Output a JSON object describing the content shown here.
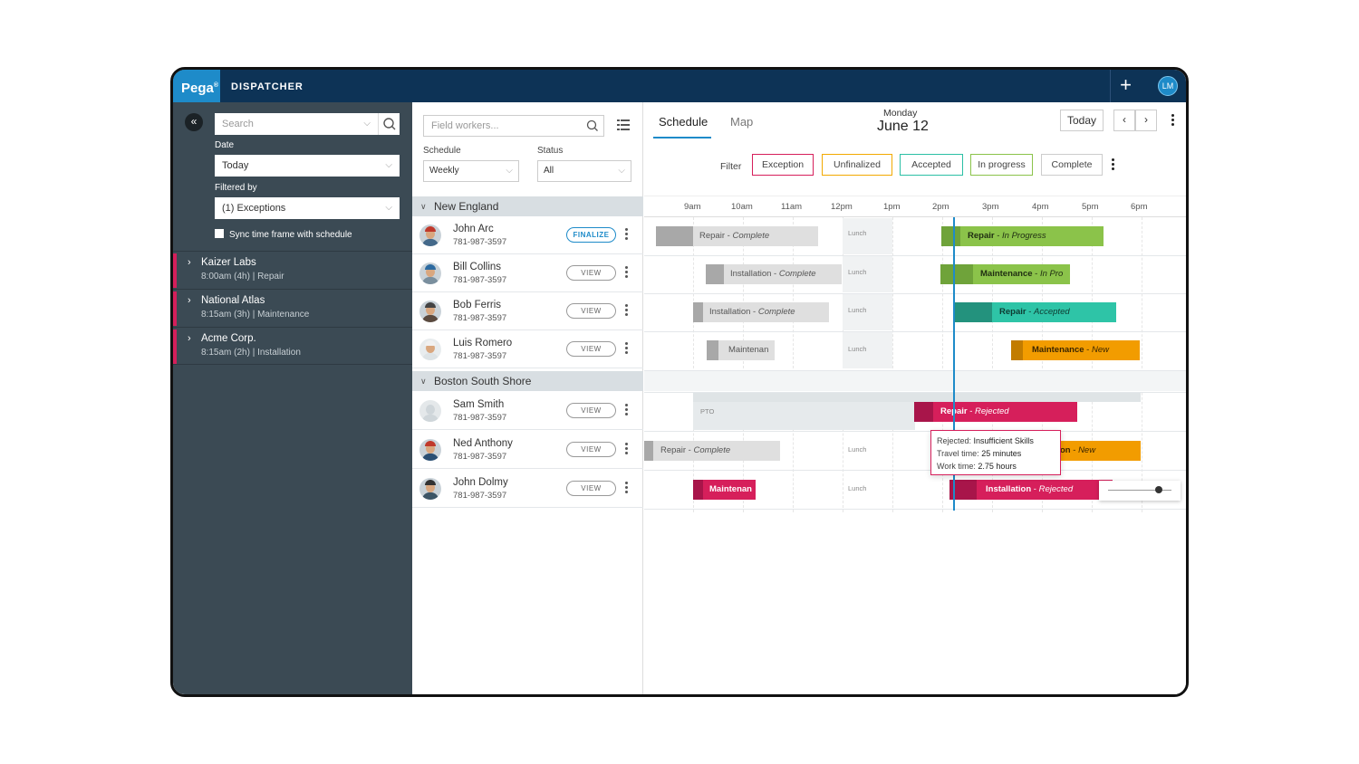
{
  "app": {
    "logo": "Pega",
    "logo_mark": "®",
    "title": "DISPATCHER",
    "user_initials": "LM"
  },
  "left_panel": {
    "search_placeholder": "Search",
    "date_label": "Date",
    "date_value": "Today",
    "filtered_label": "Filtered by",
    "filtered_value": "(1) Exceptions",
    "sync_label": "Sync time frame with schedule",
    "jobs": [
      {
        "title": "Kaizer Labs",
        "sub": "8:00am (4h) | Repair"
      },
      {
        "title": "National Atlas",
        "sub": "8:15am (3h) | Maintenance"
      },
      {
        "title": "Acme Corp.",
        "sub": "8:15am (2h) | Installation"
      }
    ]
  },
  "middle_panel": {
    "search_placeholder": "Field workers...",
    "schedule_label": "Schedule",
    "schedule_value": "Weekly",
    "status_label": "Status",
    "status_value": "All",
    "groups": [
      {
        "name": "New England",
        "workers": [
          {
            "name": "John Arc",
            "phone": "781-987-3597",
            "action": "FINALIZE"
          },
          {
            "name": "Bill Collins",
            "phone": "781-987-3597",
            "action": "VIEW"
          },
          {
            "name": "Bob Ferris",
            "phone": "781-987-3597",
            "action": "VIEW"
          },
          {
            "name": "Luis Romero",
            "phone": "781-987-3597",
            "action": "VIEW"
          }
        ]
      },
      {
        "name": "Boston South Shore",
        "workers": [
          {
            "name": "Sam Smith",
            "phone": "781-987-3597",
            "action": "VIEW"
          },
          {
            "name": "Ned Anthony",
            "phone": "781-987-3597",
            "action": "VIEW"
          },
          {
            "name": "John Dolmy",
            "phone": "781-987-3597",
            "action": "VIEW"
          }
        ]
      }
    ]
  },
  "schedule": {
    "tab_schedule": "Schedule",
    "tab_map": "Map",
    "day": "Monday",
    "date": "June 12",
    "today_button": "Today",
    "prev": "‹",
    "next": "›",
    "filter_label": "Filter",
    "filters": [
      {
        "label": "Exception",
        "color": "#d61f5b"
      },
      {
        "label": "Unfinalized",
        "color": "#f2a900"
      },
      {
        "label": "Accepted",
        "color": "#2bbfa4"
      },
      {
        "label": "In progress",
        "color": "#8bc34a"
      },
      {
        "label": "Complete",
        "color": "#cccccc"
      }
    ],
    "hours": [
      "9am",
      "10am",
      "11am",
      "12pm",
      "1pm",
      "2pm",
      "3pm",
      "4pm",
      "5pm",
      "6pm"
    ],
    "lunch_label": "Lunch",
    "pto_label": "PTO",
    "appointments": [
      {
        "row": 0,
        "type": "Repair",
        "status": "Complete"
      },
      {
        "row": 0,
        "type": "Repair",
        "status": "In Progress"
      },
      {
        "row": 1,
        "type": "Installation",
        "status": "Complete"
      },
      {
        "row": 1,
        "type": "Maintenance",
        "status": "In Pro"
      },
      {
        "row": 2,
        "type": "Installation",
        "status": "Complete"
      },
      {
        "row": 2,
        "type": "Repair",
        "status": "Accepted"
      },
      {
        "row": 3,
        "type": "Maintenan",
        "status": ""
      },
      {
        "row": 3,
        "type": "Maintenance",
        "status": "New"
      },
      {
        "row": 4,
        "type": "Repair",
        "status": "Rejected"
      },
      {
        "row": 5,
        "type": "Repair",
        "status": "Complete"
      },
      {
        "row": 5,
        "type": "on",
        "status": "New"
      },
      {
        "row": 6,
        "type": "Maintenan",
        "status": ""
      },
      {
        "row": 6,
        "type": "Installation",
        "status": "Rejected"
      }
    ],
    "tooltip": {
      "line1_label": "Rejected: ",
      "line1_value": "Insufficient Skills",
      "line2_label": "Travel time: ",
      "line2_value": "25 minutes",
      "line3_label": "Work time: ",
      "line3_value": "2.75 hours"
    },
    "zoom_level": 0.8,
    "colors": {
      "complete": "#d9d9d9",
      "in_progress": "#8bc34a",
      "accepted": "#2bbfa4",
      "new": "#f29c00",
      "rejected": "#d61f5b"
    }
  }
}
